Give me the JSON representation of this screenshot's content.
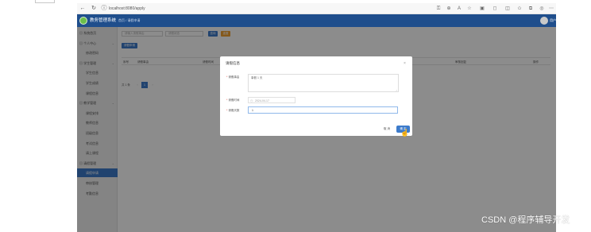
{
  "browser": {
    "url": "localhost:8080/apply",
    "toolbar_icons": [
      "key-icon",
      "zoom-icon",
      "read-aloud-icon",
      "star-icon",
      "tab-icon",
      "shield-icon",
      "split-icon",
      "favorites-icon",
      "collections-icon",
      "more-icon"
    ]
  },
  "header": {
    "app_title": "教务管理系统",
    "breadcrumb": "首页 / 请假申请",
    "user_name": "用户"
  },
  "sidebar": {
    "items": [
      {
        "label": "系统首页",
        "kind": "group"
      },
      {
        "label": "个人中心",
        "kind": "group"
      },
      {
        "label": "修改密码",
        "kind": "sub"
      },
      {
        "label": "学生管理",
        "kind": "group"
      },
      {
        "label": "学生信息",
        "kind": "sub"
      },
      {
        "label": "学生成绩",
        "kind": "sub"
      },
      {
        "label": "课程信息",
        "kind": "sub"
      },
      {
        "label": "教学管理",
        "kind": "group"
      },
      {
        "label": "课程安排",
        "kind": "sub"
      },
      {
        "label": "教师信息",
        "kind": "sub"
      },
      {
        "label": "班级信息",
        "kind": "sub"
      },
      {
        "label": "考试信息",
        "kind": "sub"
      },
      {
        "label": "请上课程",
        "kind": "sub"
      },
      {
        "label": "请假管理",
        "kind": "group"
      },
      {
        "label": "请假申请",
        "kind": "sub",
        "active": true
      },
      {
        "label": "审核管理",
        "kind": "sub"
      },
      {
        "label": "考勤信息",
        "kind": "sub"
      }
    ]
  },
  "main": {
    "filter_placeholder_1": "请输入请假事由",
    "filter_placeholder_2": "请假状态",
    "search_label": "查询",
    "reset_label": "重置",
    "add_label": "请假申请",
    "columns": [
      "序号",
      "请假事由",
      "请假时间",
      "请假天数",
      "审核状态",
      "审核回复",
      "操作"
    ],
    "pager_total": "共 1 条",
    "page_number": "1"
  },
  "modal": {
    "title": "请假信息",
    "close_glyph": "×",
    "reason_label": "请假事由",
    "reason_value": "事假 1 天",
    "time_label": "请假时间",
    "time_value": "2024-04-17",
    "days_label": "请假天数",
    "days_value": "1",
    "cancel_label": "取 消",
    "confirm_label": "确 定"
  },
  "watermark": "CSDN @程序辅导开发"
}
